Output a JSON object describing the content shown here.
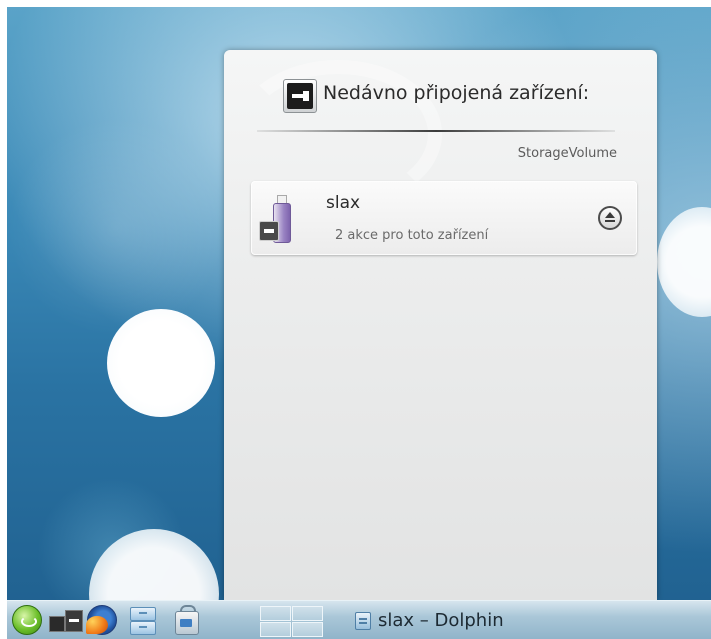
{
  "device_notifier": {
    "header_title": "Nedávno připojená zařízení:",
    "header_icon": "device-notifier-icon",
    "category": "StorageVolume",
    "devices": [
      {
        "name": "slax",
        "actions_text": "2 akce pro toto zařízení",
        "icon": "usb-drive-icon",
        "action_icon": "eject-icon"
      }
    ]
  },
  "taskbar": {
    "launchers": [
      {
        "icon": "kickoff-menu-icon"
      },
      {
        "icon": "device-notifier-icon"
      },
      {
        "icon": "firefox-icon"
      },
      {
        "icon": "file-manager-icon"
      },
      {
        "icon": "package-manager-icon"
      }
    ],
    "pager_desktops": 4,
    "tasks": [
      {
        "label": "slax – Dolphin",
        "icon": "dolphin-icon"
      }
    ]
  }
}
